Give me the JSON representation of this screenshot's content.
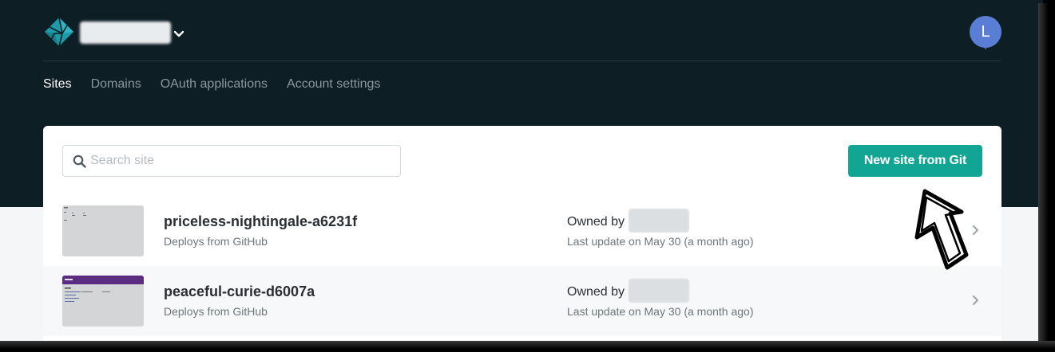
{
  "header": {
    "team_chevron_icon": "chevron-down-icon",
    "avatar_initial": "L",
    "avatar_color": "#5a7ed3",
    "background_color": "#0e1e25"
  },
  "nav": {
    "items": [
      {
        "label": "Sites",
        "active": true
      },
      {
        "label": "Domains",
        "active": false
      },
      {
        "label": "OAuth applications",
        "active": false
      },
      {
        "label": "Account settings",
        "active": false
      }
    ]
  },
  "search": {
    "placeholder": "Search site",
    "value": ""
  },
  "toolbar": {
    "new_site_label": "New site from Git",
    "accent_color": "#12a594"
  },
  "sites": [
    {
      "name": "priceless-nightingale-a6231f",
      "deploy_source": "Deploys from GitHub",
      "owned_label": "Owned by",
      "last_update": "Last update on May 30 (a month ago)"
    },
    {
      "name": "peaceful-curie-d6007a",
      "deploy_source": "Deploys from GitHub",
      "owned_label": "Owned by",
      "last_update": "Last update on May 30 (a month ago)"
    }
  ]
}
